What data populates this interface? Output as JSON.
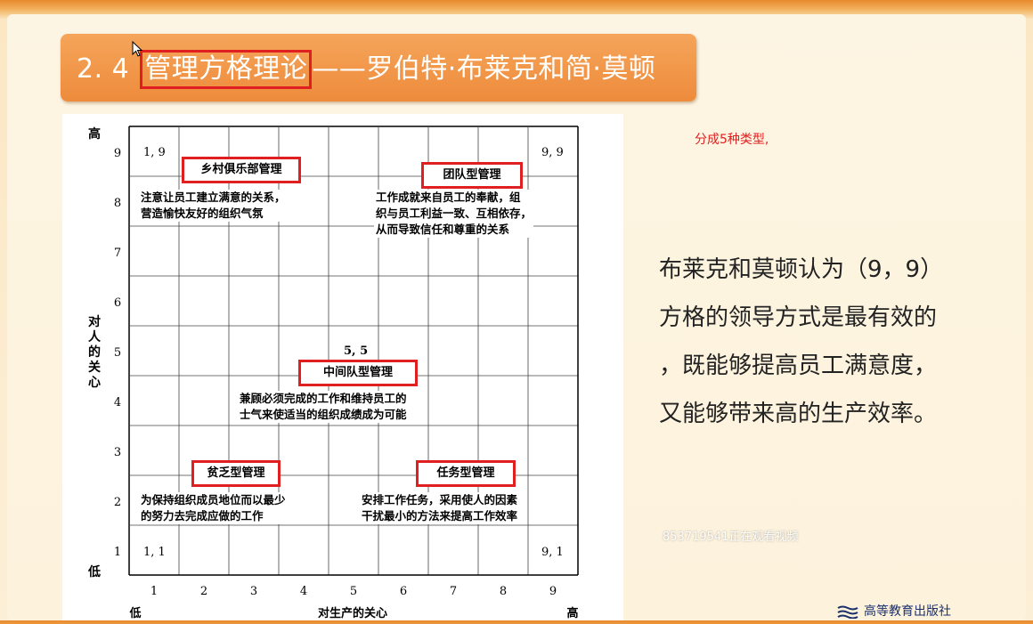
{
  "title": {
    "prefix": "2. 4",
    "highlight": "管理方格理论",
    "suffix": "——罗伯特·布莱克和简·莫顿"
  },
  "grid": {
    "y_axis": {
      "high": "高",
      "low": "低",
      "label": "对人的关心",
      "ticks": [
        "9",
        "8",
        "7",
        "6",
        "5",
        "4",
        "3",
        "2",
        "1"
      ]
    },
    "x_axis": {
      "low": "低",
      "high": "高",
      "label": "对生产的关心",
      "ticks": [
        "1",
        "2",
        "3",
        "4",
        "5",
        "6",
        "7",
        "8",
        "9"
      ]
    },
    "corner_labels": {
      "top_left": "1, 9",
      "top_right": "9, 9",
      "center": "5, 5",
      "bottom_left": "1, 1",
      "bottom_right": "9, 1"
    }
  },
  "styles": [
    {
      "name": "乡村俱乐部管理",
      "lines": [
        "注意让员工建立满意的关系，",
        "营造愉快友好的组织气氛"
      ]
    },
    {
      "name": "团队型管理",
      "lines": [
        "工作成就来自员工的奉献，组",
        "织与员工利益一致、互相依存，",
        "从而导致信任和尊重的关系"
      ]
    },
    {
      "name": "中间队型管理",
      "lines": [
        "兼顾必须完成的工作和维持员工的",
        "士气来使适当的组织成绩成为可能"
      ]
    },
    {
      "name": "贫乏型管理",
      "lines": [
        "为保持组织成员地位而以最少",
        "的努力去完成应做的工作"
      ]
    },
    {
      "name": "任务型管理",
      "lines": [
        "安排工作任务，采用使人的因素",
        "干扰最小的方法来提高工作效率"
      ]
    }
  ],
  "side_note": "分成5种类型,",
  "conclusion": [
    "布莱克和莫顿认为（9，9）",
    "方格的领导方式是最有效的",
    "，既能够提高员工满意度，",
    "又能够带来高的生产效率。"
  ],
  "watermark": "853719541正在观看视频",
  "publisher": "高等教育出版社",
  "colors": {
    "title_bar": "#ee8b3c",
    "highlight_border": "#e02020",
    "background": "#fdf2dc"
  }
}
